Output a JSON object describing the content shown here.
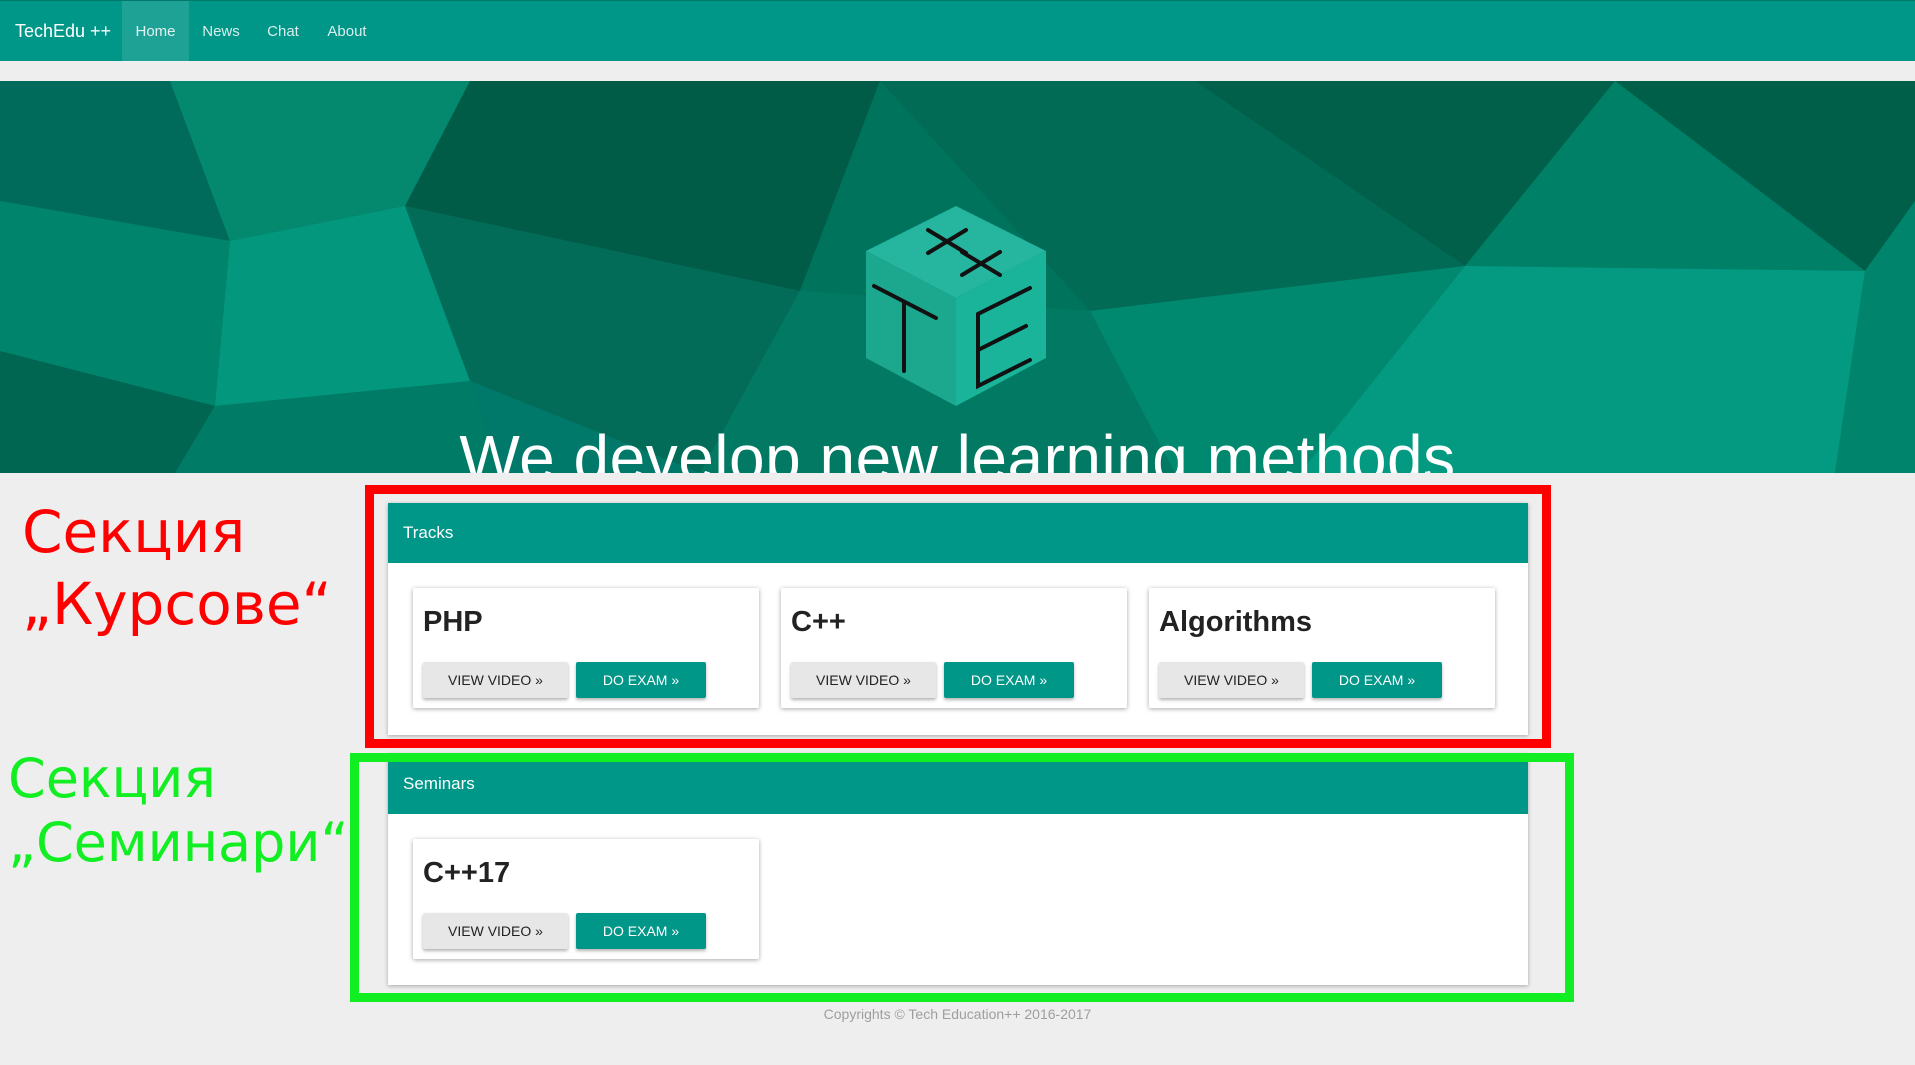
{
  "nav": {
    "brand": "TechEdu ++",
    "items": [
      {
        "label": "Home",
        "active": true
      },
      {
        "label": "News",
        "active": false
      },
      {
        "label": "Chat",
        "active": false
      },
      {
        "label": "About",
        "active": false
      }
    ]
  },
  "hero": {
    "title": "We develop new learning methods",
    "logo_letters": "TE++"
  },
  "annotations": {
    "tracks_label_line1": "Секция",
    "tracks_label_line2": "„Курсове“",
    "seminars_label_line1": "Секция",
    "seminars_label_line2": "„Семинари“",
    "tracks_color": "#ff0000",
    "seminars_color": "#11ee22"
  },
  "sections": {
    "tracks": {
      "title": "Tracks",
      "cards": [
        {
          "title": "PHP",
          "video_label": "VIEW VIDEO »",
          "exam_label": "DO EXAM »"
        },
        {
          "title": "C++",
          "video_label": "VIEW VIDEO »",
          "exam_label": "DO EXAM »"
        },
        {
          "title": "Algorithms",
          "video_label": "VIEW VIDEO »",
          "exam_label": "DO EXAM »"
        }
      ]
    },
    "seminars": {
      "title": "Seminars",
      "cards": [
        {
          "title": "C++17",
          "video_label": "VIEW VIDEO »",
          "exam_label": "DO EXAM »"
        }
      ]
    }
  },
  "footer": {
    "text": "Copyrights © Tech Education++ 2016-2017"
  },
  "colors": {
    "primary": "#009688",
    "hero_dark": "#00695c",
    "button_light": "#e7e7e7"
  }
}
